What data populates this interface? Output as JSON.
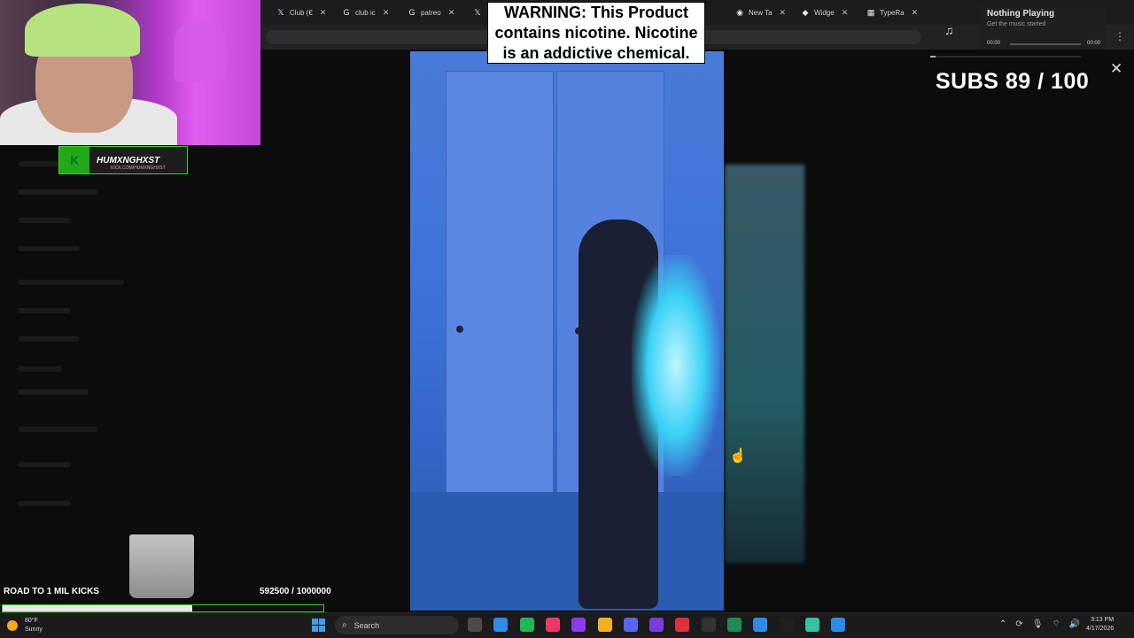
{
  "browser": {
    "tabs": [
      {
        "icon": "x-logo-icon",
        "label": "Club (€"
      },
      {
        "icon": "google-icon",
        "label": "club ic"
      },
      {
        "icon": "google-icon",
        "label": "patreo"
      },
      {
        "icon": "x-logo-icon",
        "label": ""
      },
      {
        "icon": "ring-icon",
        "label": "New Ta"
      },
      {
        "icon": "diamond-icon",
        "label": "Widge"
      },
      {
        "icon": "typeracer-icon",
        "label": "TypeRa"
      }
    ],
    "menu_label": "⋮"
  },
  "overlay": {
    "streamer_name": "HUMXNGHXST",
    "streamer_url": "KICK.COM/HUMXNGHXST",
    "warning_text": "WARNING: This Product contains nicotine. Nicotine is an addictive chemical.",
    "subs_goal": "SUBS 89 / 100",
    "kicks_label": "ROAD TO 1 MIL KICKS",
    "kicks_count": "592500 / 1000000",
    "kicks_progress": 0.5925
  },
  "now_playing": {
    "title": "Nothing Playing",
    "subtitle": "Get the music started",
    "time_elapsed": "00:00",
    "time_total": "00:00"
  },
  "taskbar": {
    "weather_temp": "80°F",
    "weather_desc": "Sunny",
    "search_label": "Search",
    "time": "3:13 PM",
    "date": "4/17/2026",
    "apps": [
      {
        "name": "file-explorer-icon",
        "color": "#4a4a4a"
      },
      {
        "name": "chrome-icon",
        "color": "#2f8ae8"
      },
      {
        "name": "spotify-icon",
        "color": "#1db954"
      },
      {
        "name": "music-app-icon",
        "color": "#f0366b"
      },
      {
        "name": "app-purple-icon",
        "color": "#8a3cf0"
      },
      {
        "name": "folder-icon",
        "color": "#f2b01e"
      },
      {
        "name": "discord-icon",
        "color": "#5865f2"
      },
      {
        "name": "app-violet-icon",
        "color": "#7a3ce0"
      },
      {
        "name": "app-red-icon",
        "color": "#e0303a"
      },
      {
        "name": "app-dark-icon",
        "color": "#333"
      },
      {
        "name": "app-green-icon",
        "color": "#1e8a5a"
      },
      {
        "name": "chrome-active-icon",
        "color": "#2f8ae8"
      },
      {
        "name": "obs-icon",
        "color": "#202020"
      },
      {
        "name": "streamlabs-icon",
        "color": "#31c3a2"
      },
      {
        "name": "chrome-2-icon",
        "color": "#2f8ae8"
      }
    ]
  }
}
